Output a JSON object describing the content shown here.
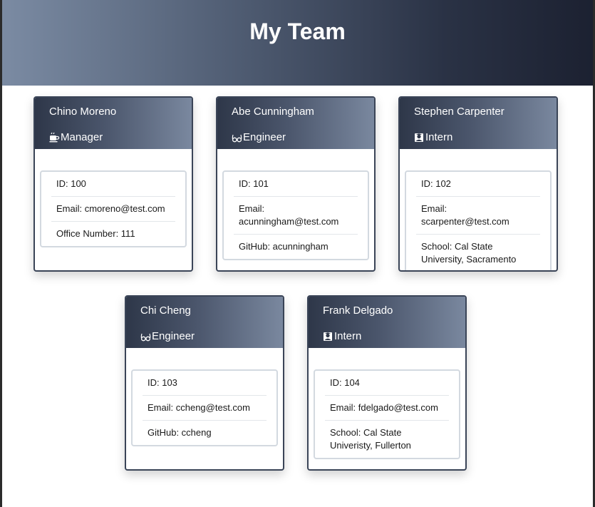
{
  "header": {
    "title": "My Team"
  },
  "employees": [
    {
      "name": "Chino Moreno",
      "role": "Manager",
      "role_icon": "coffee-icon",
      "id": "ID: 100",
      "email": "Email: cmoreno@test.com",
      "extra": "Office Number: 111"
    },
    {
      "name": "Abe Cunningham",
      "role": "Engineer",
      "role_icon": "glasses-icon",
      "id": "ID: 101",
      "email": "Email: acunningham@test.com",
      "extra": "GitHub: acunningham"
    },
    {
      "name": "Stephen Carpenter",
      "role": "Intern",
      "role_icon": "user-graduate-icon",
      "id": "ID: 102",
      "email": "Email: scarpenter@test.com",
      "extra": "School: Cal State University, Sacramento"
    },
    {
      "name": "Chi Cheng",
      "role": "Engineer",
      "role_icon": "glasses-icon",
      "id": "ID: 103",
      "email": "Email: ccheng@test.com",
      "extra": "GitHub: ccheng"
    },
    {
      "name": "Frank Delgado",
      "role": "Intern",
      "role_icon": "user-graduate-icon",
      "id": "ID: 104",
      "email": "Email: fdelgado@test.com",
      "extra": "School: Cal State Univeristy, Fullerton"
    }
  ],
  "colors": {
    "header_dark": "#1c2131",
    "header_light": "#7b8ba3",
    "card_border": "#3a4457"
  }
}
